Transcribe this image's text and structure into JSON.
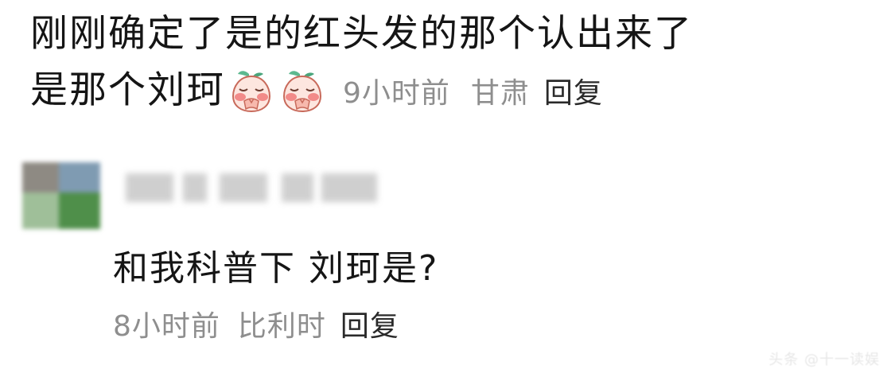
{
  "comment": {
    "line1": "刚刚确定了是的红头发的那个认出来了",
    "line2": "是那个刘珂",
    "emojis": [
      "crying-peach-emoji",
      "crying-peach-emoji"
    ],
    "time": "9小时前",
    "location": "甘肃",
    "reply_label": "回复"
  },
  "reply": {
    "text": "和我科普下 刘珂是?",
    "time": "8小时前",
    "location": "比利时",
    "reply_label": "回复"
  },
  "watermark": "头条 @十一读娱",
  "colors": {
    "text_primary": "#151515",
    "text_meta": "#8e8e8e",
    "background": "#ffffff"
  }
}
